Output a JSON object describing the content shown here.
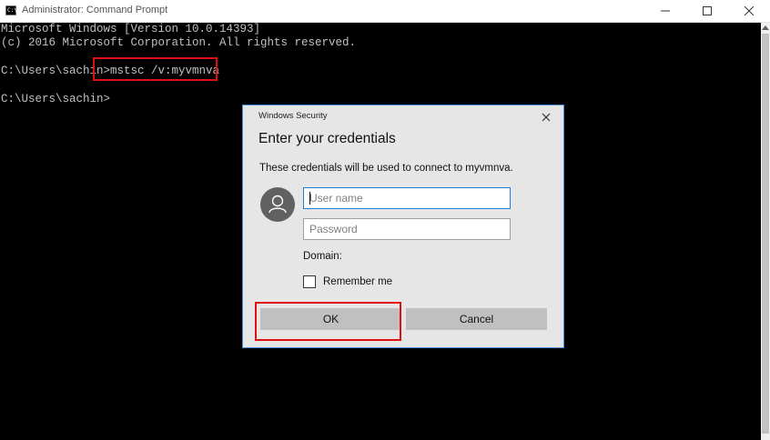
{
  "window": {
    "icon_text": "C:\\",
    "title": "Administrator: Command Prompt"
  },
  "console": {
    "lines": [
      "Microsoft Windows [Version 10.0.14393]",
      "(c) 2016 Microsoft Corporation. All rights reserved.",
      "C:\\Users\\sachin>mstsc /v:myvmnva",
      "C:\\Users\\sachin>"
    ]
  },
  "dialog": {
    "header": "Windows Security",
    "heading": "Enter your credentials",
    "description": "These credentials will be used to connect to myvmnva.",
    "username_placeholder": "User name",
    "password_placeholder": "Password",
    "domain_label": "Domain:",
    "remember_label": "Remember me",
    "ok_label": "OK",
    "cancel_label": "Cancel"
  },
  "colors": {
    "console_bg": "#000000",
    "console_text": "#c0c0c0",
    "highlight": "#e01010",
    "dialog_bg": "#e6e6e6",
    "accent": "#2a7bd4"
  }
}
